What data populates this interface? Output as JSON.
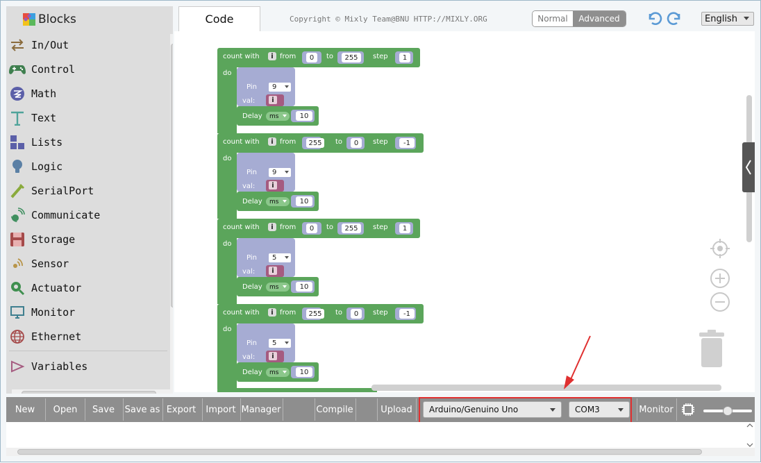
{
  "sidebar": {
    "title": "Blocks",
    "items": [
      {
        "label": "In/Out",
        "icon": "arrows-icon"
      },
      {
        "label": "Control",
        "icon": "gamepad-icon"
      },
      {
        "label": "Math",
        "icon": "math-icon"
      },
      {
        "label": "Text",
        "icon": "text-icon"
      },
      {
        "label": "Lists",
        "icon": "lists-icon"
      },
      {
        "label": "Logic",
        "icon": "bulb-icon"
      },
      {
        "label": "SerialPort",
        "icon": "serial-icon"
      },
      {
        "label": "Communicate",
        "icon": "satellite-icon"
      },
      {
        "label": "Storage",
        "icon": "floppy-icon"
      },
      {
        "label": "Sensor",
        "icon": "sensor-icon"
      },
      {
        "label": "Actuator",
        "icon": "actuator-icon"
      },
      {
        "label": "Monitor",
        "icon": "monitor-icon"
      },
      {
        "label": "Ethernet",
        "icon": "globe-icon"
      },
      {
        "label": "Variables",
        "icon": "variables-icon"
      }
    ]
  },
  "header": {
    "code_tab": "Code",
    "copyright": "Copyright © Mixly Team@BNU HTTP://MIXLY.ORG",
    "mode_normal": "Normal",
    "mode_advanced": "Advanced",
    "language": "English"
  },
  "blocks": {
    "count_with": "count with",
    "from": "from",
    "to": "to",
    "step": "step",
    "do": "do",
    "pin": "Pin",
    "val": "val:",
    "delay": "Delay",
    "ms": "ms",
    "var": "i",
    "loops": [
      {
        "from": "0",
        "to": "255",
        "step": "1",
        "pin": "9",
        "delay": "10"
      },
      {
        "from": "255",
        "to": "0",
        "step": "-1",
        "pin": "9",
        "delay": "10"
      },
      {
        "from": "0",
        "to": "255",
        "step": "1",
        "pin": "5",
        "delay": "10"
      },
      {
        "from": "255",
        "to": "0",
        "step": "-1",
        "pin": "5",
        "delay": "10"
      }
    ]
  },
  "toolbar": {
    "new": "New",
    "open": "Open",
    "save": "Save",
    "save_as": "Save as",
    "export": "Export",
    "import": "Import",
    "manager": "Manager",
    "compile": "Compile",
    "upload": "Upload",
    "board": "Arduino/Genuino Uno",
    "port": "COM3",
    "monitor": "Monitor"
  },
  "colors": {
    "loop_block": "#5ba55b",
    "pin_block": "#a6acd3",
    "var_block": "#a55b80",
    "toolbar": "#8e8e8e",
    "highlight": "#e03030"
  }
}
